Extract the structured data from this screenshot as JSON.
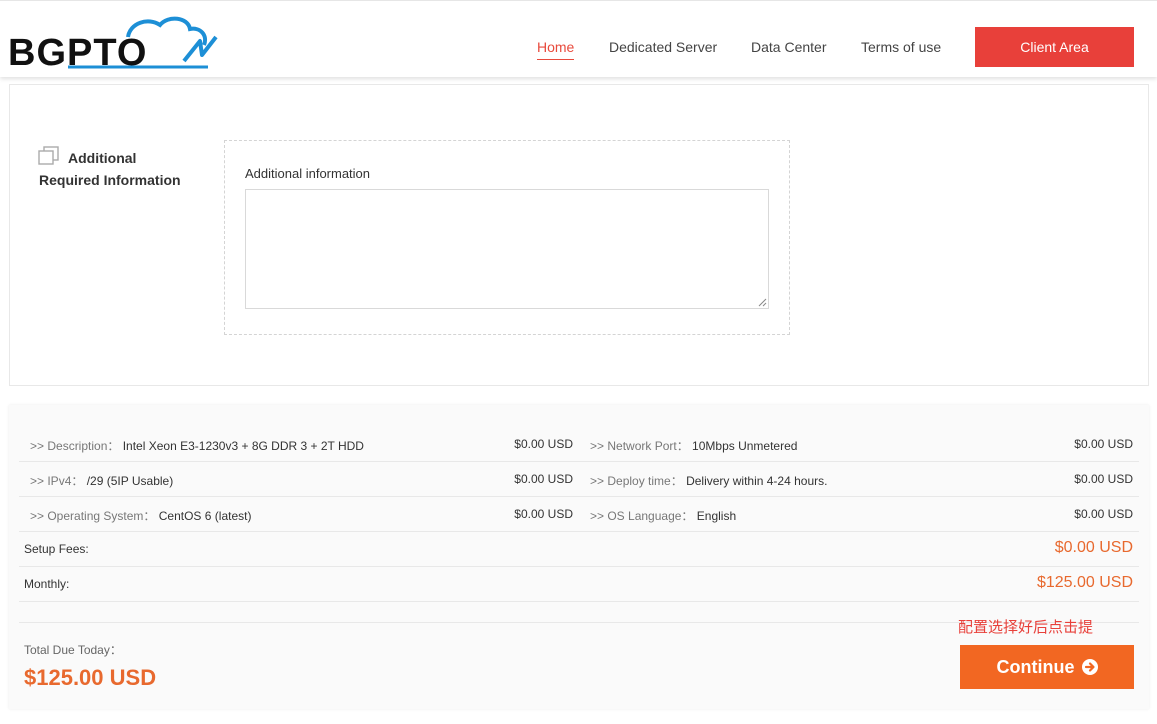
{
  "brand": {
    "name": "BGPTO",
    "accent": "#e8403a",
    "logo_blue": "#1d8fd6"
  },
  "nav": {
    "items": [
      {
        "label": "Home",
        "active": true
      },
      {
        "label": "Dedicated Server",
        "active": false
      },
      {
        "label": "Data Center",
        "active": false
      },
      {
        "label": "Terms of use",
        "active": false
      }
    ],
    "client_area": "Client Area"
  },
  "additional": {
    "icon": "copy-icon",
    "title_line1": "Additional",
    "title_line2": "Required Information",
    "field_label": "Additional information",
    "field_value": ""
  },
  "summary": {
    "items": [
      {
        "key": ">> Description：",
        "value": "Intel Xeon E3-1230v3 + 8G DDR 3 + 2T HDD",
        "price": "$0.00 USD"
      },
      {
        "key": ">> Network Port：",
        "value": "10Mbps Unmetered",
        "price": "$0.00 USD"
      },
      {
        "key": ">> IPv4：",
        "value": "/29 (5IP Usable)",
        "price": "$0.00 USD"
      },
      {
        "key": ">> Deploy time：",
        "value": "Delivery within 4-24 hours.",
        "price": "$0.00 USD"
      },
      {
        "key": ">> Operating System：",
        "value": "CentOS 6 (latest)",
        "price": "$0.00 USD"
      },
      {
        "key": ">> OS Language：",
        "value": "English",
        "price": "$0.00 USD"
      }
    ],
    "setup_fees_label": "Setup Fees:",
    "setup_fees_value": "$0.00 USD",
    "monthly_label": "Monthly:",
    "monthly_value": "$125.00 USD",
    "total_label": "Total Due Today：",
    "total_value": "$125.00 USD",
    "hint": "配置选择好后点击提",
    "continue_label": "Continue",
    "continue_icon": "arrow-circle-right-icon",
    "price_color": "#e8692e"
  }
}
